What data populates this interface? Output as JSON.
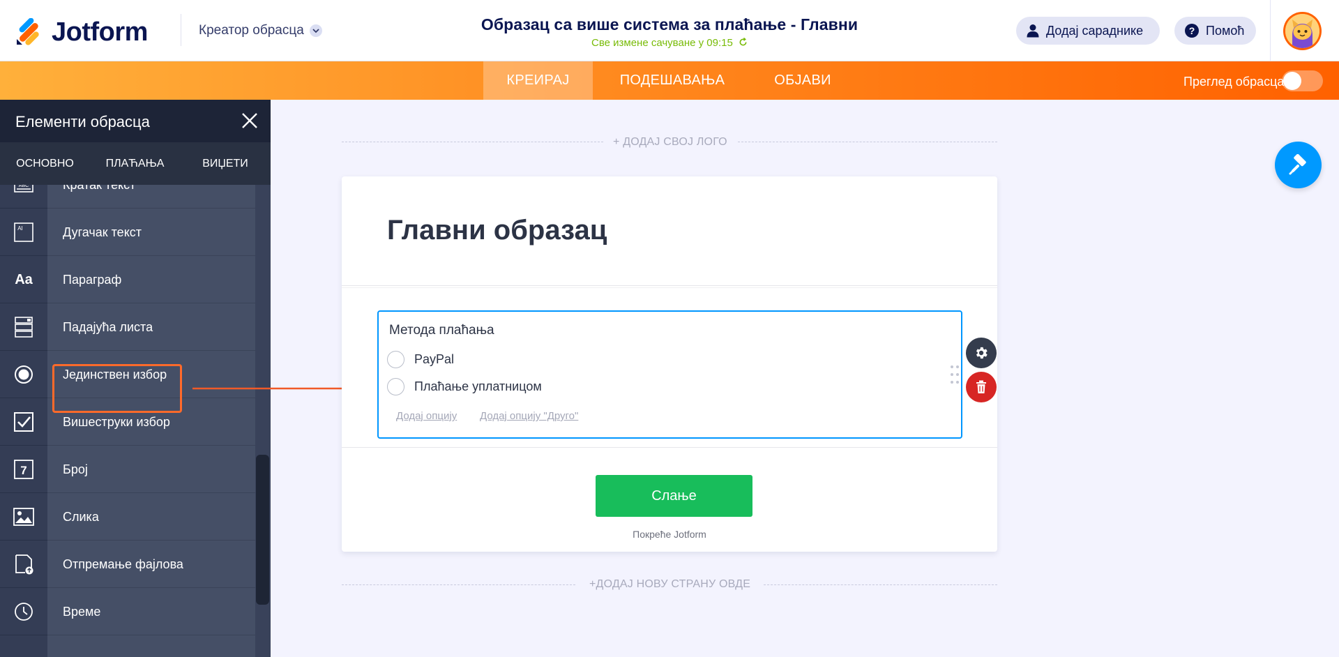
{
  "header": {
    "logo_text": "Jotform",
    "builder_label": "Креатор обрасца",
    "form_title": "Образац са више система за плаћање - Главни",
    "save_status": "Све измене сачуване у 09:15",
    "collab_label": "Додај сараднике",
    "help_label": "Помоћ"
  },
  "nav": {
    "tabs": [
      {
        "label": "КРЕИРАЈ",
        "active": true
      },
      {
        "label": "ПОДЕШАВАЊА",
        "active": false
      },
      {
        "label": "ОБЈАВИ",
        "active": false
      }
    ],
    "preview_label": "Преглед обрасца",
    "preview_enabled": false
  },
  "sidebar": {
    "title": "Елементи обрасца",
    "tabs": [
      {
        "label": "ОСНОВНО",
        "active": true
      },
      {
        "label": "ПЛАЋАЊА",
        "active": false
      },
      {
        "label": "ВИЏЕТИ",
        "active": false
      }
    ],
    "items": [
      {
        "label": "Кратак текст",
        "icon": "short-text-icon"
      },
      {
        "label": "Дугачак текст",
        "icon": "long-text-icon"
      },
      {
        "label": "Параграф",
        "icon": "paragraph-icon"
      },
      {
        "label": "Падајућа листа",
        "icon": "dropdown-icon"
      },
      {
        "label": "Јединствен избор",
        "icon": "single-choice-icon",
        "highlighted": true
      },
      {
        "label": "Вишеструки избор",
        "icon": "multiple-choice-icon"
      },
      {
        "label": "Број",
        "icon": "number-icon"
      },
      {
        "label": "Слика",
        "icon": "image-icon"
      },
      {
        "label": "Отпремање фајлова",
        "icon": "file-upload-icon"
      },
      {
        "label": "Време",
        "icon": "time-icon"
      }
    ]
  },
  "canvas": {
    "add_logo_label": "+ ДОДАЈ СВОЈ ЛОГО",
    "form_heading": "Главни образац",
    "field": {
      "label": "Метода плаћања",
      "options": [
        "PayPal",
        "Плаћање уплатницом"
      ],
      "add_option": "Додај опцију",
      "add_other": "Додај опцију \"Друго\""
    },
    "submit_label": "Слање",
    "powered_by": "Покреће Jotform",
    "add_page_label": "+ДОДАЈ НОВУ СТРАНУ ОВДЕ"
  },
  "colors": {
    "accent": "#ff6100",
    "primary_blue": "#0096ff",
    "submit_green": "#18bd5b",
    "delete_red": "#d72624",
    "save_green": "#78bb07"
  }
}
